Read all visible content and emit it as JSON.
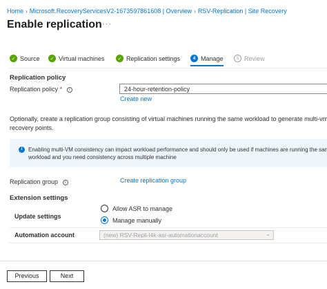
{
  "breadcrumb": [
    "Home",
    "Microsoft.RecoveryServicesV2-1673597861608 | Overview",
    "RSV-Replication | Site Recovery"
  ],
  "page_title": "Enable replication",
  "more_label": "···",
  "steps": [
    {
      "label": "Source",
      "status": "done"
    },
    {
      "label": "Virtual machines",
      "status": "done"
    },
    {
      "label": "Replication settings",
      "status": "done"
    },
    {
      "label": "Manage",
      "status": "current",
      "number": "4"
    },
    {
      "label": "Review",
      "status": "pending",
      "number": "5"
    }
  ],
  "replication_policy": {
    "section_title": "Replication policy",
    "label": "Replication policy",
    "required_mark": "*",
    "value": "24-hour-retention-policy",
    "create_new": "Create new"
  },
  "group_description": "Optionally, create a replication group consisting of virtual machines running the same workload to generate multi-vm consistent recovery points.",
  "group_description_line1": "Optionally, create a replication group consisting of virtual machines running the same workload to generate multi-vm consiste",
  "group_description_line2": "recovery points.",
  "info_banner": {
    "line1": "Enabling multi-VM consistency can impact workload performance and should only be used if machines are running the same",
    "line2": "workload and you need consistency across multiple machine"
  },
  "replication_group": {
    "label": "Replication group",
    "link": "Create replication group"
  },
  "extension_settings": {
    "section_title": "Extension settings",
    "update_label": "Update settings",
    "options": [
      {
        "label": "Allow ASR to manage",
        "selected": false
      },
      {
        "label": "Manage manually",
        "selected": true
      }
    ],
    "automation_label": "Automation account",
    "automation_value": "(new) RSV-Repli-l4k-asr-automationaccount"
  },
  "footer": {
    "previous": "Previous",
    "next": "Next"
  },
  "colors": {
    "accent": "#0078d4",
    "success": "#57a300",
    "banner_bg": "#eff6fc"
  }
}
